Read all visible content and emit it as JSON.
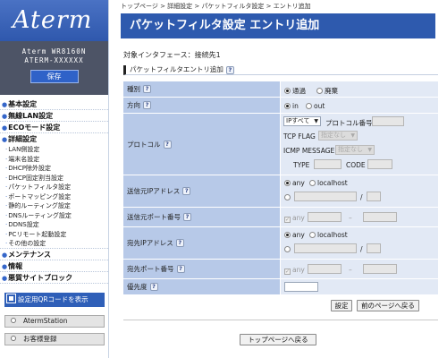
{
  "sidebar": {
    "logo": "Aterm",
    "model_line1": "Aterm WR8160N",
    "model_line2": "ATERM-XXXXXX",
    "save_label": "保存",
    "nav": [
      {
        "label": "基本設定",
        "children": []
      },
      {
        "label": "無線LAN設定",
        "children": []
      },
      {
        "label": "ECOモード設定",
        "children": []
      },
      {
        "label": "詳細設定",
        "children": [
          "LAN側設定",
          "端末名設定",
          "DHCP除外設定",
          "DHCP固定割当設定",
          "パケットフィルタ設定",
          "ポートマッピング設定",
          "静的ルーティング設定",
          "DNSルーティング設定",
          "DDNS設定",
          "PCリモート起動設定",
          "その他の設定"
        ]
      },
      {
        "label": "メンテナンス",
        "children": []
      },
      {
        "label": "情報",
        "children": []
      },
      {
        "label": "悪質サイトブロック",
        "children": []
      }
    ],
    "qr_label": "設定用QRコードを表示",
    "aterm_station_label": "AtermStation",
    "register_label": "お客様登録"
  },
  "breadcrumb": "トップページ > 詳細設定 > パケットフィルタ設定 > エントリ追加",
  "page_title": "パケットフィルタ設定 エントリ追加",
  "interface_line": "対象インタフェース：接続先1",
  "section_title": "パケットフィルタエントリ追加",
  "form": {
    "type": {
      "label": "種別",
      "opt1": "通過",
      "opt2": "廃棄",
      "selected": "通過"
    },
    "direction": {
      "label": "方向",
      "opt1": "in",
      "opt2": "out",
      "selected": "in"
    },
    "protocol": {
      "label": "プロトコル",
      "select_value": "IPすべて",
      "number_label": "プロトコル番号",
      "tcp_flag_label": "TCP FLAG",
      "tcp_flag_value": "指定なし",
      "icmp_label": "ICMP MESSAGE",
      "icmp_value": "指定なし",
      "type_label": "TYPE",
      "code_label": "CODE"
    },
    "src_ip": {
      "label": "送信元IPアドレス",
      "opt_any": "any",
      "opt_localhost": "localhost",
      "selected": "any",
      "slash": "/"
    },
    "src_port": {
      "label": "送信元ポート番号",
      "any": "any",
      "dash": "–"
    },
    "dst_ip": {
      "label": "宛先IPアドレス",
      "opt_any": "any",
      "opt_localhost": "localhost",
      "selected": "any",
      "slash": "/"
    },
    "dst_port": {
      "label": "宛先ポート番号",
      "any": "any",
      "dash": "–"
    },
    "priority": {
      "label": "優先度"
    }
  },
  "buttons": {
    "set": "設定",
    "back": "前のページへ戻る",
    "top": "トップページへ戻る"
  },
  "icons": {
    "help": "?"
  }
}
